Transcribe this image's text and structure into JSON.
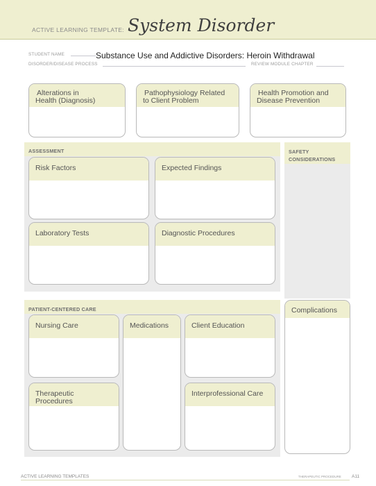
{
  "header": {
    "template_label": "ACTIVE LEARNING TEMPLATE:",
    "title": "System Disorder"
  },
  "fields": {
    "student_name_label": "STUDENT NAME",
    "student_name_value": "Substance Use and Addictive Disorders: Heroin Withdrawal",
    "disorder_label": "DISORDER/DISEASE PROCESS",
    "review_label": "REVIEW MODULE CHAPTER"
  },
  "top_boxes": [
    {
      "line1": "Alterations in",
      "line2": "Health (Diagnosis)"
    },
    {
      "line1": "Pathophysiology Related",
      "line2": "to Client Problem"
    },
    {
      "line1": "Health Promotion and",
      "line2": "Disease Prevention"
    }
  ],
  "assessment": {
    "title": "ASSESSMENT",
    "boxes": [
      "Risk Factors",
      "Expected Findings",
      "Laboratory Tests",
      "Diagnostic Procedures"
    ]
  },
  "safety": {
    "line1": "SAFETY",
    "line2": "CONSIDERATIONS"
  },
  "patient_care": {
    "title": "PATIENT-CENTERED CARE",
    "boxes": [
      "Nursing Care",
      "Medications",
      "Client Education",
      "Therapeutic Procedures",
      "Interprofessional Care"
    ]
  },
  "complications": {
    "title": "Complications"
  },
  "footer": {
    "left": "ACTIVE LEARNING TEMPLATES",
    "right": "THERAPEUTIC PROCEDURE",
    "page": "A11"
  }
}
